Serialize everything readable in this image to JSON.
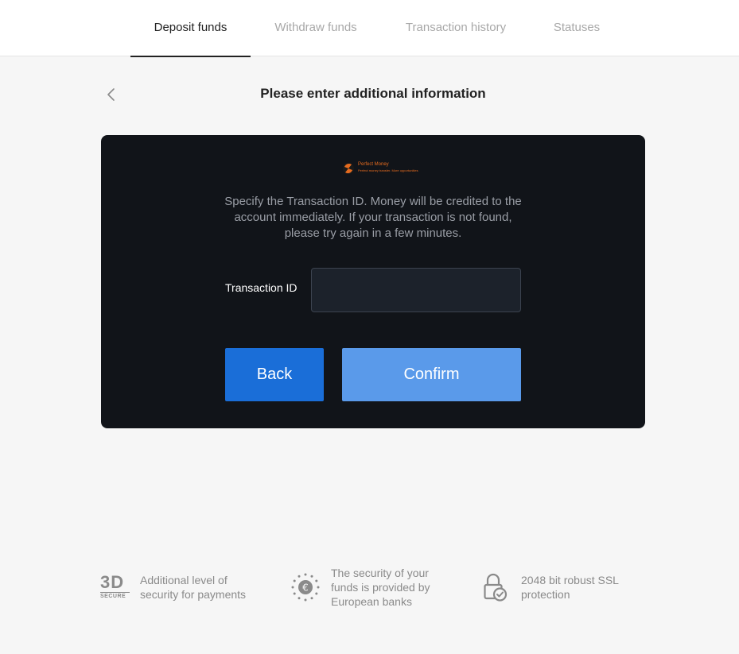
{
  "tabs": [
    {
      "label": "Deposit funds",
      "active": true
    },
    {
      "label": "Withdraw funds",
      "active": false
    },
    {
      "label": "Transaction history",
      "active": false
    },
    {
      "label": "Statuses",
      "active": false
    }
  ],
  "header": {
    "title": "Please enter additional information",
    "back_icon": "chevron-left-icon"
  },
  "card": {
    "logo": {
      "name": "Perfect Money",
      "tagline": "Perfect money transfer. More opportunities"
    },
    "instructions": "Specify the Transaction ID. Money will be credited to the account immediately. If your transaction is not found, please try again in a few minutes.",
    "field": {
      "label": "Transaction ID",
      "value": "",
      "placeholder": ""
    },
    "buttons": {
      "back_label": "Back",
      "confirm_label": "Confirm"
    }
  },
  "features": [
    {
      "icon": "3d-secure-icon",
      "icon_text": "3D",
      "icon_subtext": "SECURE",
      "text": "Additional level of security for payments"
    },
    {
      "icon": "euro-stars-icon",
      "text": "The security of your funds is provided by European banks"
    },
    {
      "icon": "padlock-check-icon",
      "text": "2048 bit robust SSL protection"
    }
  ],
  "colors": {
    "page_bg": "#f6f6f6",
    "card_bg": "#111419",
    "primary": "#1a6ed8",
    "primary_light": "#5a9aea",
    "input_bg": "#1c222b",
    "muted_text": "#8a8a8a"
  }
}
